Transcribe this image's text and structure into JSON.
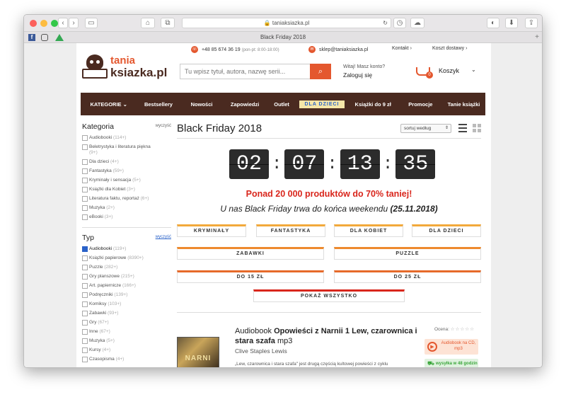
{
  "browser": {
    "url": "taniaksiazka.pl",
    "tab_title": "Black Friday 2018"
  },
  "header": {
    "phone": "+48 85 674 36 19",
    "phone_hours": "(pon-pt: 8:00-18:00)",
    "email": "sklep@taniaksiazka.pl",
    "contact": "Kontakt ›",
    "shipping": "Koszt dostawy ›",
    "logo_top": "tania",
    "logo_bottom": "ksiazka.pl",
    "search_placeholder": "Tu wpisz tytuł, autora, nazwę serii...",
    "welcome": "Witaj! Masz konto?",
    "login": "Zaloguj się",
    "cart": "Koszyk",
    "cart_count": "0"
  },
  "nav": [
    "KATEGORIE ⌄",
    "Bestsellery",
    "Nowości",
    "Zapowiedzi",
    "Outlet",
    "DLA DZIECI",
    "Książki do 9 zł",
    "Promocje",
    "Tanie książki"
  ],
  "sidebar": {
    "kategoria_title": "Kategoria",
    "clear": "wyczyść",
    "kategoria_items": [
      {
        "label": "Audiobooki",
        "count": "(114+)"
      },
      {
        "label": "Beletrystyka i literatura piękna",
        "count": "(9+)"
      },
      {
        "label": "Dla dzieci",
        "count": "(4+)"
      },
      {
        "label": "Fantastyka",
        "count": "(59+)"
      },
      {
        "label": "Kryminały i sensacja",
        "count": "(5+)"
      },
      {
        "label": "Książki dla Kobiet",
        "count": "(3+)"
      },
      {
        "label": "Literatura faktu, reportaż",
        "count": "(6+)"
      },
      {
        "label": "Muzyka",
        "count": "(2+)"
      },
      {
        "label": "eBooki",
        "count": "(3+)"
      }
    ],
    "typ_title": "Typ",
    "typ_items": [
      {
        "label": "Audiobooki",
        "count": "(119+)"
      },
      {
        "label": "Książki papierowe",
        "count": "(8390+)"
      },
      {
        "label": "Puzzle",
        "count": "(282+)"
      },
      {
        "label": "Gry planszowe",
        "count": "(215+)"
      },
      {
        "label": "Art. papiernicze",
        "count": "(166+)"
      },
      {
        "label": "Podręczniki",
        "count": "(139+)"
      },
      {
        "label": "Komiksy",
        "count": "(103+)"
      },
      {
        "label": "Zabawki",
        "count": "(93+)"
      },
      {
        "label": "Gry",
        "count": "(67+)"
      },
      {
        "label": "Inne",
        "count": "(67+)"
      },
      {
        "label": "Muzyka",
        "count": "(5+)"
      },
      {
        "label": "Kursy",
        "count": "(4+)"
      },
      {
        "label": "Czasopisma",
        "count": "(4+)"
      }
    ]
  },
  "main": {
    "title": "Black Friday 2018",
    "sort": "sortuj według",
    "timer": [
      "02",
      "07",
      "13",
      "35"
    ],
    "promo": "Ponad 20 000 produktów do 70% taniej!",
    "subpromo": "U nas Black Friday trwa do końca weekendu",
    "subpromo_date": "(25.11.2018)",
    "categories": [
      "KRYMINAŁY",
      "FANTASTYKA",
      "DLA KOBIET",
      "DLA DZIECI",
      "ZABAWKI",
      "PUZZLE",
      "DO 15 ZŁ",
      "DO 25 ZŁ",
      "POKAŻ WSZYSTKO"
    ]
  },
  "product": {
    "type": "Audiobook",
    "title": "Opowieści z Narnii 1 Lew, czarownica i stara szafa",
    "format": "mp3",
    "author": "Clive Staples Lewis",
    "rating_label": "Ocena:",
    "badge": "Audiobook na CD, mp3",
    "description": "„Lew, czarownica i stara szafa\" jest drugą częścią kultowej powieści z cyklu",
    "shipping": "wysyłka w 48 godzin"
  }
}
